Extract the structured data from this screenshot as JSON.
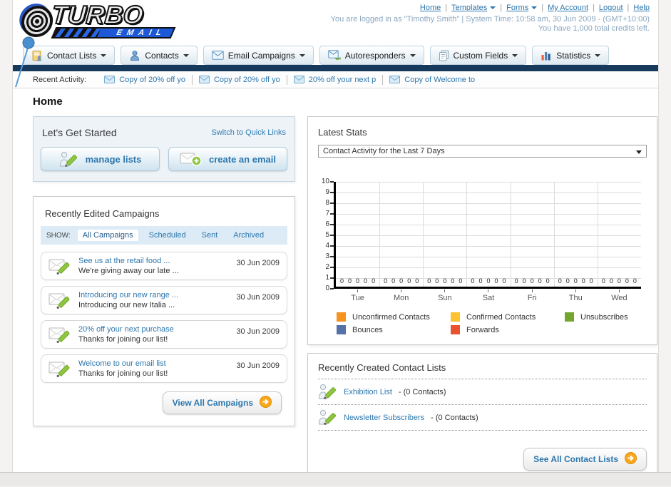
{
  "colors": {
    "navy_bar": "#16395c",
    "link_blue": "#2d77ad",
    "accent_orange": "#f9a71c",
    "pencil_green": "#8dc63f"
  },
  "header": {
    "logo_line1": "TURBO",
    "logo_line2": "EMAIL",
    "nav_links": [
      {
        "label": "Home",
        "dropdown": false
      },
      {
        "label": "Templates",
        "dropdown": true
      },
      {
        "label": "Forms",
        "dropdown": true
      },
      {
        "label": "My Account",
        "dropdown": false
      },
      {
        "label": "Logout",
        "dropdown": false
      },
      {
        "label": "Help",
        "dropdown": false
      }
    ],
    "login_line1": "You are logged in as \"Timothy Smith\" | System Time: 10:58 am, 30 Jun 2009 - (GMT+10:00)",
    "login_line2": "You have 1,000 total credits left."
  },
  "tabs": [
    {
      "label": "Contact Lists",
      "icon": "contact-lists-icon"
    },
    {
      "label": "Contacts",
      "icon": "contacts-icon"
    },
    {
      "label": "Email Campaigns",
      "icon": "email-campaigns-icon"
    },
    {
      "label": "Autoresponders",
      "icon": "autoresponders-icon"
    },
    {
      "label": "Custom Fields",
      "icon": "custom-fields-icon"
    },
    {
      "label": "Statistics",
      "icon": "statistics-icon"
    }
  ],
  "recent_activity": {
    "label": "Recent Activity:",
    "items": [
      "Copy of 20% off yo",
      "Copy of 20% off yo",
      "20% off your next p",
      "Copy of Welcome to"
    ]
  },
  "page_title": "Home",
  "get_started": {
    "title": "Let's Get Started",
    "switch_link": "Switch to Quick Links",
    "buttons": [
      {
        "label": "manage lists",
        "icon": "person-pencil-icon"
      },
      {
        "label": "create an email",
        "icon": "envelope-plus-icon"
      }
    ]
  },
  "campaigns": {
    "title": "Recently Edited Campaigns",
    "show_label": "SHOW:",
    "filters": [
      "All Campaigns",
      "Scheduled",
      "Sent",
      "Archived"
    ],
    "active_filter": "All Campaigns",
    "items": [
      {
        "title": "See us at the retail food ...",
        "subtitle": "We're giving away our late ...",
        "date": "30 Jun 2009"
      },
      {
        "title": "Introducing our new range ...",
        "subtitle": "Introducing our new Italia ...",
        "date": "30 Jun 2009"
      },
      {
        "title": "20% off your next purchase",
        "subtitle": "Thanks for joining our list!",
        "date": "30 Jun 2009"
      },
      {
        "title": "Welcome to our email list",
        "subtitle": "Thanks for joining our list!",
        "date": "30 Jun 2009"
      }
    ],
    "view_all_label": "View All Campaigns"
  },
  "stats": {
    "title": "Latest Stats",
    "dropdown_value": "Contact Activity for the Last 7 Days"
  },
  "chart_data": {
    "type": "bar",
    "title": "Contact Activity for the Last 7 Days",
    "categories": [
      "Tue",
      "Mon",
      "Sun",
      "Sat",
      "Fri",
      "Thu",
      "Wed"
    ],
    "series": [
      {
        "name": "Unconfirmed Contacts",
        "color": "#f6921e",
        "values": [
          0,
          0,
          0,
          0,
          0,
          0,
          0
        ]
      },
      {
        "name": "Confirmed Contacts",
        "color": "#fdc22d",
        "values": [
          0,
          0,
          0,
          0,
          0,
          0,
          0
        ]
      },
      {
        "name": "Unsubscribes",
        "color": "#74a52c",
        "values": [
          0,
          0,
          0,
          0,
          0,
          0,
          0
        ]
      },
      {
        "name": "Bounces",
        "color": "#5572a8",
        "values": [
          0,
          0,
          0,
          0,
          0,
          0,
          0
        ]
      },
      {
        "name": "Forwards",
        "color": "#e9532d",
        "values": [
          0,
          0,
          0,
          0,
          0,
          0,
          0
        ]
      }
    ],
    "ylim": [
      0,
      10
    ],
    "ytick_step": 1,
    "grid": true,
    "legend_position": "bottom",
    "bar_value_labels_shown": true
  },
  "contact_lists": {
    "title": "Recently Created Contact Lists",
    "items": [
      {
        "name": "Exhibition List",
        "detail": "- (0 Contacts)"
      },
      {
        "name": "Newsletter Subscribers",
        "detail": "- (0 Contacts)"
      }
    ],
    "see_all_label": "See All Contact Lists"
  }
}
